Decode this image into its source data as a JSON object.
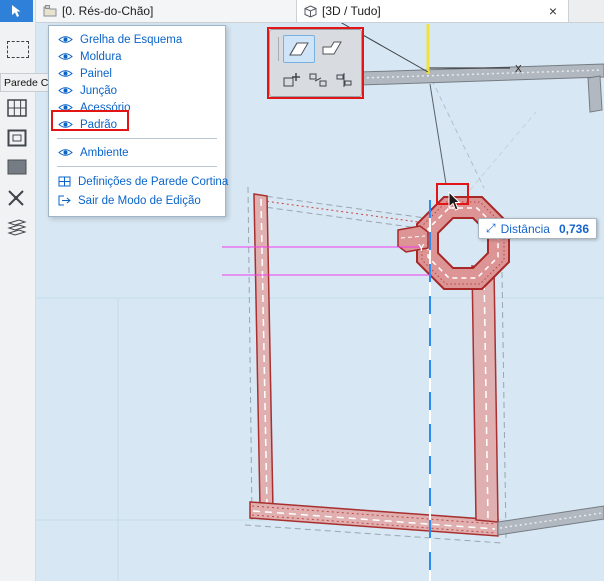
{
  "tabs": {
    "tab1": "[0. Rés-do-Chão]",
    "tab2": "[3D / Tudo]",
    "close": "×"
  },
  "toolbar": {
    "panel_label": "Parede C"
  },
  "menu": {
    "items": [
      {
        "label": "Grelha de Esquema"
      },
      {
        "label": "Moldura"
      },
      {
        "label": "Painel"
      },
      {
        "label": "Junção"
      },
      {
        "label": "Acessório"
      },
      {
        "label": "Padrão"
      },
      {
        "label": "Ambiente"
      },
      {
        "label": "Definições de Parede Cortina"
      },
      {
        "label": "Sair de Modo de Edição"
      }
    ]
  },
  "viewport": {
    "axis_x": "X",
    "axis_y": "Y",
    "tooltip_label": "Distância",
    "tooltip_value": "0,736"
  },
  "icons": {
    "measure_arrows": "⤢",
    "close": "×"
  },
  "colors": {
    "menu_blue": "#0a64c8",
    "annotation_red": "#e21414",
    "selection_red": "#a83030",
    "member_fill": "#e0b0b0",
    "magenta_guide": "#f03cf0",
    "blue_guide": "#2a8cf0",
    "yellow_edge": "#f2e23c",
    "viewport_bg": "#d7e7f3",
    "tool_selected_bg": "#2f80d8"
  }
}
